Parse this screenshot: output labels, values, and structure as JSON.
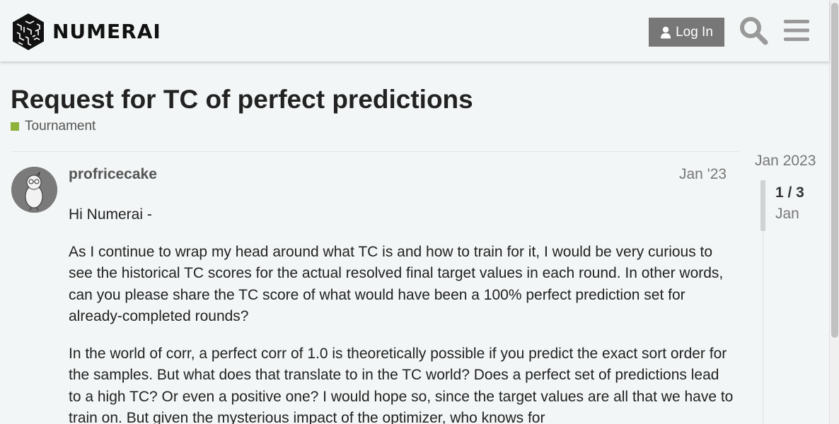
{
  "header": {
    "logo_text": "NUMERAI",
    "login_label": "Log In",
    "icons": {
      "login": "user-icon",
      "search": "search-icon",
      "menu": "hamburger-menu-icon"
    }
  },
  "topic": {
    "title": "Request for TC of perfect predictions",
    "category": "Tournament",
    "category_color": "#8fb23a"
  },
  "post": {
    "username": "profricecake",
    "date": "Jan '23",
    "paragraphs": [
      "Hi Numerai -",
      "As I continue to wrap my head around what TC is and how to train for it, I would be very curious to see the historical TC scores for the actual resolved final target values in each round. In other words, can you please share the TC score of what would have been a 100% perfect prediction set for already-completed rounds?",
      "In the world of corr, a perfect corr of 1.0 is theoretically possible if you predict the exact sort order for the samples. But what does that translate to in the TC world? Does a perfect set of predictions lead to a high TC? Or even a positive one? I would hope so, since the target values are all that we have to train on. But given the mysterious impact of the optimizer, who knows for"
    ]
  },
  "timeline": {
    "top_date": "Jan 2023",
    "counter": "1 / 3",
    "month": "Jan"
  },
  "colors": {
    "background": "#f3f6f6",
    "login_button": "#777777",
    "icon_gray": "#999999"
  }
}
